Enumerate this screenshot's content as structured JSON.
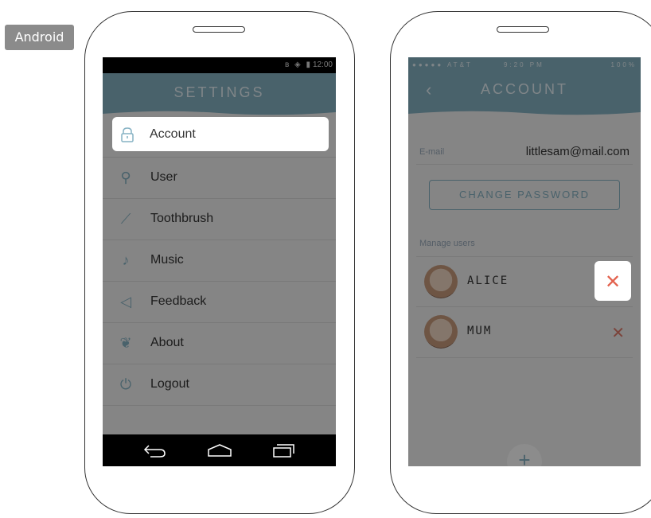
{
  "badge": "Android",
  "android": {
    "status_time": "12:00",
    "title": "SETTINGS",
    "menu": [
      {
        "label": "Account",
        "icon": "lock-icon"
      },
      {
        "label": "User",
        "icon": "user-icon"
      },
      {
        "label": "Toothbrush",
        "icon": "toothbrush-icon"
      },
      {
        "label": "Music",
        "icon": "music-note-icon"
      },
      {
        "label": "Feedback",
        "icon": "paper-plane-icon"
      },
      {
        "label": "About",
        "icon": "leaf-icon"
      },
      {
        "label": "Logout",
        "icon": "power-icon"
      }
    ]
  },
  "ios": {
    "carrier": "●●●●● AT&T",
    "time": "9:20 PM",
    "battery": "100%",
    "title": "ACCOUNT",
    "email_label": "E-mail",
    "email_value": "littlesam@mail.com",
    "change_password": "CHANGE PASSWORD",
    "manage_label": "Manage users",
    "users": [
      {
        "name": "ALICE"
      },
      {
        "name": "MUM"
      }
    ],
    "add_label": "+"
  },
  "colors": {
    "accent": "#86b2c4",
    "delete": "#e3624e"
  }
}
